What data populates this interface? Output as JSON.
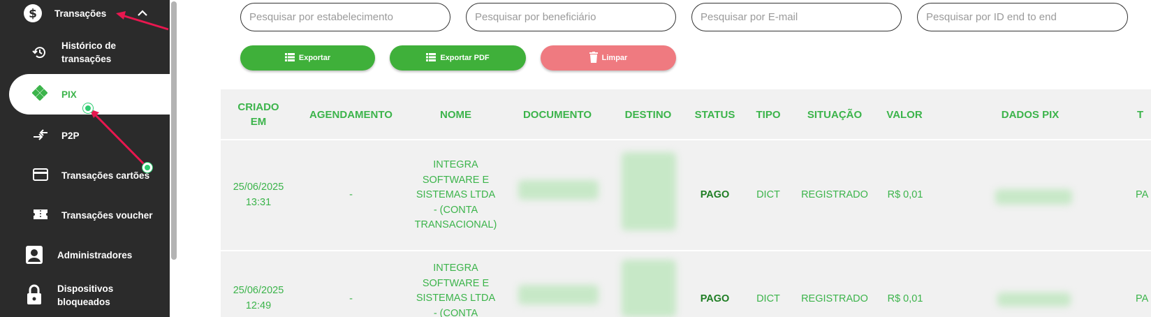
{
  "sidebar": {
    "items": [
      {
        "label": "Transações",
        "icon": "dollar-icon"
      },
      {
        "label": "Histórico de transações",
        "icon": "history-icon"
      },
      {
        "label": "PIX",
        "icon": "pix-icon"
      },
      {
        "label": "P2P",
        "icon": "transfer-arrows-icon"
      },
      {
        "label": "Transações cartões",
        "icon": "credit-card-icon"
      },
      {
        "label": "Transações voucher",
        "icon": "ticket-icon"
      },
      {
        "label": "Administradores",
        "icon": "user-badge-icon"
      },
      {
        "label": "Dispositivos bloqueados",
        "icon": "lock-icon"
      }
    ],
    "history_line1": "Histórico de",
    "history_line2": "transações",
    "devices_line1": "Dispositivos",
    "devices_line2": "bloqueados",
    "active_item": "PIX",
    "accent_color": "#2ecc71"
  },
  "filters": {
    "establishment_placeholder": "Pesquisar por estabelecimento",
    "beneficiary_placeholder": "Pesquisar por beneficiário",
    "email_placeholder": "Pesquisar por E-mail",
    "e2e_placeholder": "Pesquisar por ID end to end"
  },
  "actions": {
    "export_label": "Exportar",
    "export_pdf_label": "Exportar PDF",
    "clear_label": "Limpar"
  },
  "table": {
    "headers": {
      "created_line1": "CRIADO",
      "created_line2": "EM",
      "schedule": "AGENDAMENTO",
      "name": "NOME",
      "document": "DOCUMENTO",
      "destination": "DESTINO",
      "status": "STATUS",
      "type": "TIPO",
      "situation": "SITUAÇÃO",
      "value": "VALOR",
      "pix_data": "DADOS PIX",
      "partial": "T"
    },
    "rows": [
      {
        "date": "25/06/2025",
        "time": "13:31",
        "schedule": "-",
        "name_lines": [
          "INTEGRA",
          "SOFTWARE E",
          "SISTEMAS LTDA",
          "- (CONTA",
          "TRANSACIONAL)"
        ],
        "status": "PAGO",
        "type": "DICT",
        "situation": "REGISTRADO",
        "value": "R$ 0,01",
        "partial": "PA"
      },
      {
        "date": "25/06/2025",
        "time": "12:49",
        "schedule": "-",
        "name_lines": [
          "INTEGRA",
          "SOFTWARE E",
          "SISTEMAS LTDA",
          "- (CONTA"
        ],
        "status": "PAGO",
        "type": "DICT",
        "situation": "REGISTRADO",
        "value": "R$ 0,01",
        "partial": "PA"
      }
    ]
  },
  "colors": {
    "sidebar_bg": "#2b2b2b",
    "accent_green": "#3cb44b",
    "export_button": "#3fb03a",
    "clear_button": "#ef7a80",
    "annotation_arrow": "#e8174f"
  }
}
